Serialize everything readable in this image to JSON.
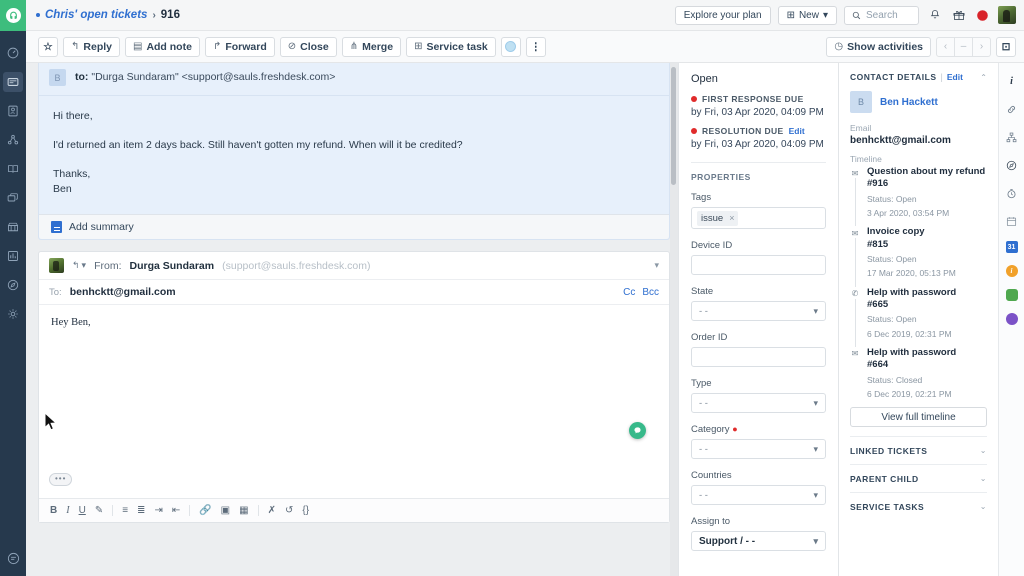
{
  "leftRail": {
    "logo_icon": "freshdesk-logo-icon",
    "items": [
      {
        "name": "dashboard-icon",
        "glyph": "◔"
      },
      {
        "name": "tickets-icon",
        "glyph": "✉",
        "active": true
      },
      {
        "name": "contacts-icon",
        "glyph": "👤"
      },
      {
        "name": "social-icon",
        "glyph": "⚯"
      },
      {
        "name": "solutions-icon",
        "glyph": "📖"
      },
      {
        "name": "forums-icon",
        "glyph": "🗨"
      },
      {
        "name": "automations-icon",
        "glyph": "🏪"
      },
      {
        "name": "reports-icon",
        "glyph": "📊"
      },
      {
        "name": "discover-icon",
        "glyph": "◑"
      },
      {
        "name": "admin-icon",
        "glyph": "⚙"
      }
    ],
    "bottom_icon": "collapse-chat-icon"
  },
  "topbar": {
    "breadcrumb_parent": "Chris' open tickets",
    "breadcrumb_sep": "›",
    "breadcrumb_current": "916",
    "explore_plan": "Explore your plan",
    "new_button": "New",
    "new_caret": "▾",
    "search_placeholder": "Search",
    "icons": [
      "bell-icon",
      "gift-icon",
      "moon-icon",
      "user-avatar"
    ]
  },
  "actionbar": {
    "star": "☆",
    "buttons": [
      {
        "label": "Reply",
        "icon": "reply-icon",
        "glyph": "↰"
      },
      {
        "label": "Add note",
        "icon": "note-icon",
        "glyph": "▤"
      },
      {
        "label": "Forward",
        "icon": "forward-icon",
        "glyph": "↱"
      },
      {
        "label": "Close",
        "icon": "close-circle-icon",
        "glyph": "⊘"
      },
      {
        "label": "Merge",
        "icon": "merge-icon",
        "glyph": "⋔"
      },
      {
        "label": "Service task",
        "icon": "service-task-icon",
        "glyph": "⊞"
      }
    ],
    "translate_icon": "translate-globe-icon",
    "more_icon": "more-vertical-icon",
    "more_glyph": "⋮",
    "show_activities": "Show activities",
    "activities_icon": "clock-icon",
    "pager": [
      "‹",
      "–",
      "›"
    ],
    "expand_icon": "expand-icon",
    "expand_glyph": "⊡"
  },
  "thread": {
    "avatar_initial": "B",
    "to_label": "to:",
    "to_value": "\"Durga Sundaram\" <support@sauls.freshdesk.com>",
    "body_lines": [
      "Hi there,",
      "I'd returned an item 2 days back. Still haven't gotten my refund. When will it be credited?",
      "Thanks,",
      "Ben"
    ],
    "add_summary": "Add summary"
  },
  "composer": {
    "from_label": "From:",
    "from_name": "Durga Sundaram",
    "from_email": "(support@sauls.freshdesk.com)",
    "reply_caret": "↰",
    "chevron": "▾",
    "to_label": "To:",
    "to_value": "benhcktt@gmail.com",
    "cc": "Cc",
    "bcc": "Bcc",
    "body_text": "Hey Ben,",
    "quote_toggle": "•••",
    "format_tools": [
      {
        "name": "bold-icon",
        "glyph": "B"
      },
      {
        "name": "italic-icon",
        "glyph": "I"
      },
      {
        "name": "underline-icon",
        "glyph": "U"
      },
      {
        "name": "highlight-icon",
        "glyph": "✎"
      },
      {
        "name": "align-left-icon",
        "glyph": "≡"
      },
      {
        "name": "align-center-icon",
        "glyph": "≣"
      },
      {
        "name": "indent-icon",
        "glyph": "⇥"
      },
      {
        "name": "outdent-icon",
        "glyph": "⇤"
      },
      {
        "name": "link-icon",
        "glyph": "🔗"
      },
      {
        "name": "image-icon",
        "glyph": "▣"
      },
      {
        "name": "table-icon",
        "glyph": "▦"
      },
      {
        "name": "clear-format-icon",
        "glyph": "✗"
      },
      {
        "name": "undo-icon",
        "glyph": "↺"
      },
      {
        "name": "code-icon",
        "glyph": "{}"
      }
    ],
    "chat_fab_icon": "chat-bubble-icon"
  },
  "properties": {
    "status": "Open",
    "first_response_due_label": "FIRST RESPONSE DUE",
    "first_response_due_value": "by Fri, 03 Apr 2020, 04:09 PM",
    "resolution_due_label": "RESOLUTION DUE",
    "resolution_due_edit": "Edit",
    "resolution_due_value": "by Fri, 03 Apr 2020, 04:09 PM",
    "section_title": "PROPERTIES",
    "fields": [
      {
        "label": "Tags",
        "type": "tags",
        "tag": "issue",
        "remove": "×"
      },
      {
        "label": "Device ID",
        "type": "text",
        "value": ""
      },
      {
        "label": "State",
        "type": "select",
        "value": "- -"
      },
      {
        "label": "Order ID",
        "type": "text",
        "value": ""
      },
      {
        "label": "Type",
        "type": "select",
        "value": "- -"
      },
      {
        "label": "Category",
        "type": "select",
        "value": "- -",
        "required": true
      },
      {
        "label": "Countries",
        "type": "select",
        "value": "- -"
      },
      {
        "label": "Assign to",
        "type": "select",
        "value": "Support / - -",
        "filled": true
      }
    ]
  },
  "contact": {
    "panel_title": "CONTACT DETAILS",
    "edit": "Edit",
    "collapse": "⌃",
    "avatar_initial": "B",
    "name": "Ben Hackett",
    "email_label": "Email",
    "email_value": "benhcktt@gmail.com",
    "timeline_label": "Timeline",
    "timeline": [
      {
        "icon": "envelope-icon",
        "glyph": "✉",
        "subject": "Question about my refund",
        "id": "#916",
        "status": "Status: Open",
        "date": "3 Apr 2020, 03:54 PM"
      },
      {
        "icon": "envelope-icon",
        "glyph": "✉",
        "subject": "Invoice copy",
        "id": "#815",
        "status": "Status: Open",
        "date": "17 Mar 2020, 05:13 PM"
      },
      {
        "icon": "phone-icon",
        "glyph": "✆",
        "subject": "Help with password",
        "id": "#665",
        "status": "Status: Open",
        "date": "6 Dec 2019, 02:31 PM"
      },
      {
        "icon": "envelope-icon",
        "glyph": "✉",
        "subject": "Help with password",
        "id": "#664",
        "status": "Status: Closed",
        "date": "6 Dec 2019, 02:21 PM"
      }
    ],
    "view_full_timeline": "View full timeline",
    "accordions": [
      {
        "label": "LINKED TICKETS",
        "chev": "⌄"
      },
      {
        "label": "PARENT CHILD",
        "chev": "⌄"
      },
      {
        "label": "SERVICE TASKS",
        "chev": "⌄"
      }
    ]
  },
  "rightRail": [
    {
      "name": "info-icon",
      "glyph": "i",
      "color": "#2b3a4a"
    },
    {
      "name": "link-icon",
      "glyph": "🔗",
      "color": "#6b7a89"
    },
    {
      "name": "hierarchy-icon",
      "glyph": "⛬",
      "color": "#6b7a89"
    },
    {
      "name": "compass-icon",
      "glyph": "◑",
      "color": "#3b4a59"
    },
    {
      "name": "timer-icon",
      "glyph": "⏱",
      "color": "#6b7a89"
    },
    {
      "name": "calendar-icon",
      "glyph": "▤",
      "color": "#8a96a2"
    },
    {
      "name": "calendar-app-icon",
      "glyph": "31",
      "color": "#2f6fd0"
    },
    {
      "name": "orange-app-icon",
      "glyph": "i",
      "color": "#f1a12a"
    },
    {
      "name": "green-app-icon",
      "glyph": "▮",
      "color": "#4fa84f"
    },
    {
      "name": "purple-app-icon",
      "glyph": "◗",
      "color": "#7b52c7"
    }
  ],
  "colors": {
    "brand_green": "#3dbd7d",
    "rail_dark": "#26394d",
    "accent_blue": "#2f6fd0",
    "due_red": "#e02b2b",
    "msg_blue": "#e7f0fb"
  }
}
